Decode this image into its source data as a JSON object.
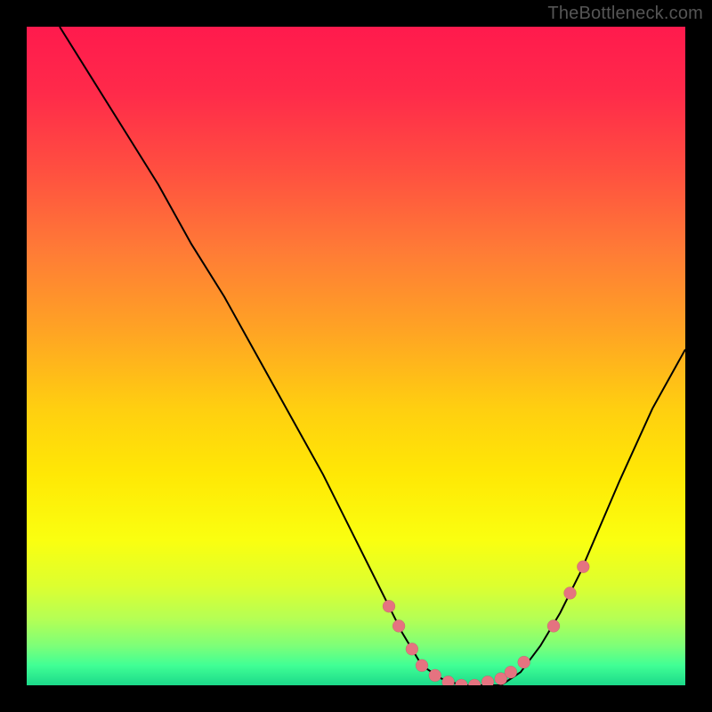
{
  "watermark": "TheBottleneck.com",
  "chart_data": {
    "type": "line",
    "title": "",
    "xlabel": "",
    "ylabel": "",
    "xlim": [
      0,
      100
    ],
    "ylim": [
      0,
      100
    ],
    "grid": false,
    "legend": false,
    "series": [
      {
        "name": "curve",
        "x": [
          5,
          10,
          15,
          20,
          25,
          30,
          35,
          40,
          45,
          50,
          55,
          57,
          60,
          63,
          66,
          69,
          72,
          75,
          78,
          81,
          84,
          87,
          90,
          95,
          100
        ],
        "y": [
          100,
          92,
          84,
          76,
          67,
          59,
          50,
          41,
          32,
          22,
          12,
          8,
          3,
          1,
          0,
          0,
          0,
          2,
          6,
          11,
          17,
          24,
          31,
          42,
          51
        ]
      },
      {
        "name": "dots",
        "x": [
          55,
          56.5,
          58.5,
          60,
          62,
          64,
          66,
          68,
          70,
          72,
          73.5,
          75.5,
          80,
          82.5,
          84.5
        ],
        "y": [
          12,
          9,
          5.5,
          3,
          1.5,
          0.5,
          0,
          0,
          0.5,
          1,
          2,
          3.5,
          9,
          14,
          18
        ]
      }
    ]
  }
}
